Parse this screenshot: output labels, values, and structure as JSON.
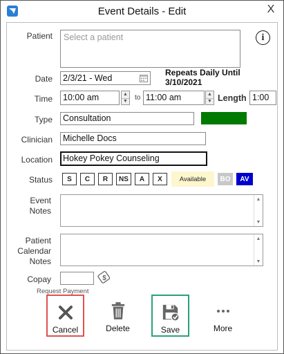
{
  "window": {
    "title": "Event Details - Edit",
    "close_glyph": "X"
  },
  "patient": {
    "label": "Patient",
    "placeholder": "Select a patient",
    "info_glyph": "i"
  },
  "date": {
    "label": "Date",
    "value": "2/3/21 - Wed",
    "repeats_line1": "Repeats Daily Until",
    "repeats_line2": "3/10/2021"
  },
  "time": {
    "label": "Time",
    "start": "10:00 am",
    "to": "to",
    "end": "11:00 am",
    "length_label": "Length",
    "length": "1:00"
  },
  "type": {
    "label": "Type",
    "value": "Consultation",
    "color": "#007a00"
  },
  "clinician": {
    "label": "Clinician",
    "value": "Michelle Docs"
  },
  "location": {
    "label": "Location",
    "value": "Hokey Pokey Counseling"
  },
  "status": {
    "label": "Status",
    "buttons": [
      "S",
      "C",
      "R",
      "NS",
      "A",
      "X"
    ],
    "availability": "Available",
    "bo": "BO",
    "av": "AV"
  },
  "event_notes": {
    "label_line1": "Event",
    "label_line2": "Notes"
  },
  "calendar_notes": {
    "label_line1": "Patient",
    "label_line2": "Calendar",
    "label_line3": "Notes"
  },
  "copay": {
    "label": "Copay",
    "value": "",
    "request_payment": "Request Payment"
  },
  "actions": {
    "cancel": "Cancel",
    "delete": "Delete",
    "save": "Save",
    "more": "More"
  },
  "colors": {
    "cancel_border": "#e05050",
    "save_border": "#2aa07a",
    "av_bg": "#0000cc",
    "bo_bg": "#c8c8c8",
    "available_bg": "#fdf6cf"
  }
}
